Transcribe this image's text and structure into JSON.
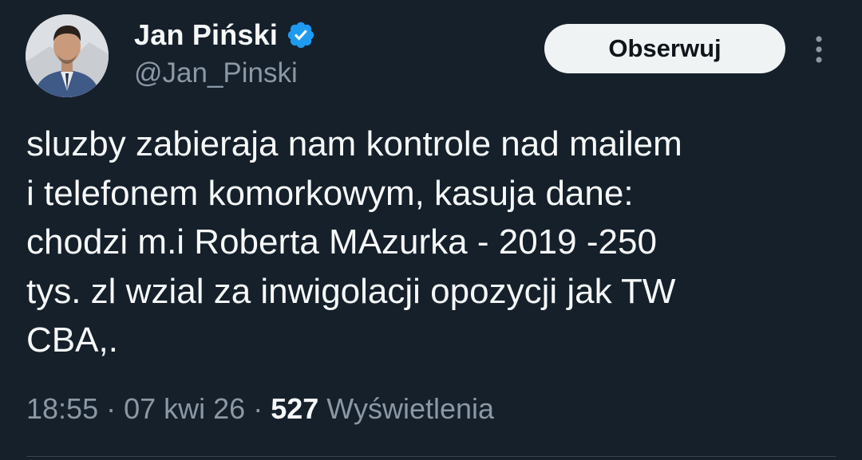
{
  "author": {
    "display_name": "Jan Piński",
    "handle": "@Jan_Pinski",
    "verified": true,
    "avatar_icon": "user-avatar"
  },
  "actions": {
    "follow_label": "Obserwuj",
    "more_icon": "more-vertical-icon"
  },
  "tweet": {
    "text": "sluzby zabieraja nam kontrole nad mailem\ni telefonem komorkowym, kasuja dane:\nchodzi m.i Roberta MAzurka - 2019 -250\ntys. zl wzial za inwigolacji opozycji jak TW\nCBA,.",
    "time": "18:55",
    "separator": " · ",
    "date": "07 kwi 26",
    "views_count": "527",
    "views_label": "Wyświetlenia"
  },
  "colors": {
    "background": "#15202b",
    "text_primary": "#f7f9f9",
    "text_secondary": "#8b98a5",
    "verified_badge": "#1d9bf0",
    "button_bg": "#eff3f4",
    "button_text": "#0f1419"
  }
}
